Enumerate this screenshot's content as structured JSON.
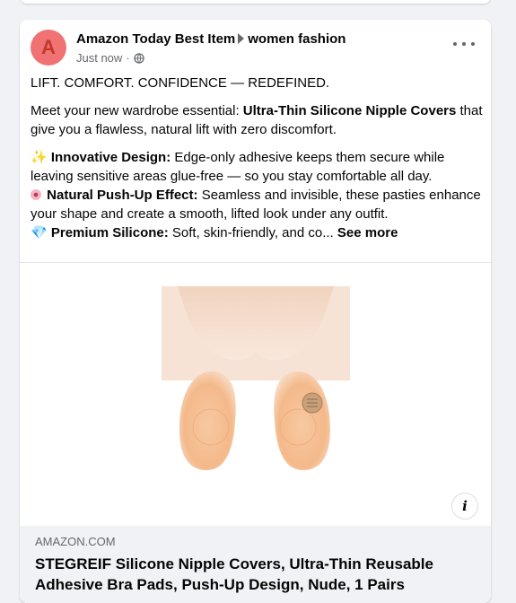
{
  "post": {
    "page_name": "Amazon Today Best Item",
    "group_name": "women fashion",
    "avatar_letter": "A",
    "timestamp": "Just now",
    "separator": "·",
    "privacy_icon": "globe-icon",
    "more_icon": "more-horizontal-icon",
    "text": {
      "headline": "LIFT. COMFORT. CONFIDENCE — REDEFINED.",
      "intro_prefix": "Meet your new wardrobe essential: ",
      "intro_bold": "Ultra-Thin Silicone Nipple Covers",
      "intro_suffix": " that give you a flawless, natural lift with zero discomfort.",
      "f1_emoji": "✨",
      "f1_title": "Innovative Design:",
      "f1_text": " Edge-only adhesive keeps them secure while leaving sensitive areas glue-free — so you stay comfortable all day.",
      "f2_emoji": "flower-emoji",
      "f2_title": "Natural Push-Up Effect:",
      "f2_text": " Seamless and invisible, these pasties enhance your shape and create a smooth, lifted look under any outfit.",
      "f3_emoji": "💎",
      "f3_title": "Premium Silicone:",
      "f3_text": " Soft, skin-friendly, and co...",
      "see_more": "See more"
    }
  },
  "link_preview": {
    "domain": "AMAZON.COM",
    "title": "STEGREIF Silicone Nipple Covers, Ultra-Thin Reusable Adhesive Bra Pads, Push-Up Design, Nude, 1 Pairs",
    "info_label": "i",
    "info_icon": "info-icon"
  },
  "colors": {
    "avatar_bg": "#f07272",
    "skin": "#f3d9c5",
    "silicone": "#f4b98a",
    "secondary_text": "#65676b",
    "feed_bg": "#f0f2f5"
  }
}
